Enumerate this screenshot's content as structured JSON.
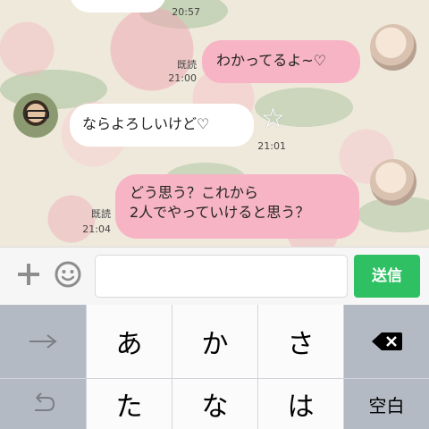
{
  "chat": {
    "messages": [
      {
        "time": "20:57"
      },
      {
        "text": "わかってるよ~♡",
        "read": "既読",
        "time": "21:00"
      },
      {
        "text": "ならよろしいけど♡",
        "time": "21:01"
      },
      {
        "text_line1": "どう思う？これから",
        "text_line2": "2人でやっていけると思う？",
        "read": "既読",
        "time": "21:04"
      }
    ]
  },
  "input": {
    "value": "",
    "placeholder": "",
    "send_label": "送信"
  },
  "keyboard": {
    "row1": [
      "あ",
      "か",
      "さ"
    ],
    "row2": [
      "た",
      "な",
      "は"
    ],
    "space_label": "空白"
  },
  "colors": {
    "sent_bubble": "#f6b4c4",
    "received_bubble": "#ffffff",
    "send_button": "#2ec063"
  },
  "icons": [
    "plus-icon",
    "emoji-icon",
    "arrow-right-icon",
    "undo-icon",
    "backspace-icon",
    "star-icon"
  ]
}
